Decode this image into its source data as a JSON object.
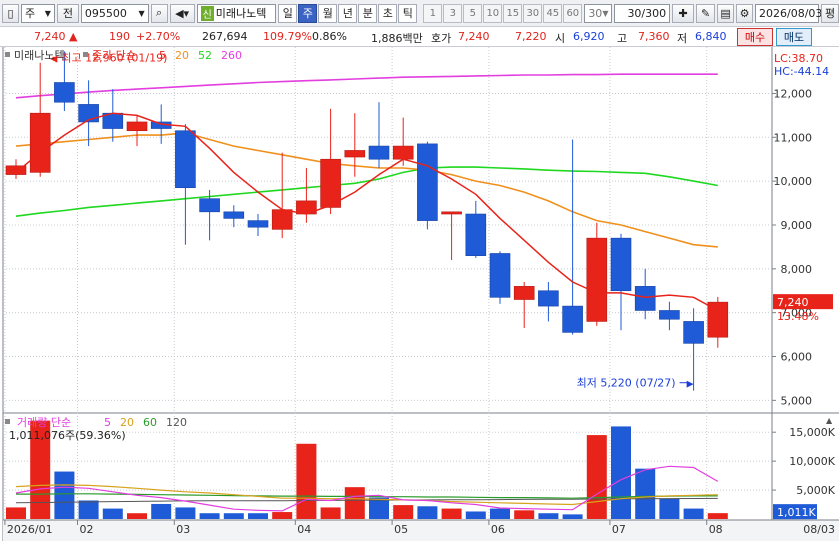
{
  "toolbar": {
    "mode": "주",
    "prev": "전",
    "code": "095500",
    "stock_tag": "신",
    "stock_name": "미래나노텍",
    "periods": [
      {
        "label": "일",
        "active": false
      },
      {
        "label": "주",
        "active": true
      },
      {
        "label": "월",
        "active": false
      },
      {
        "label": "년",
        "active": false
      },
      {
        "label": "분",
        "active": false
      },
      {
        "label": "초",
        "active": false
      },
      {
        "label": "틱",
        "active": false
      }
    ],
    "numbers": [
      "1",
      "3",
      "5",
      "10",
      "15",
      "30",
      "45",
      "60"
    ],
    "count": "30",
    "range": "30/300",
    "date": "2026/08/03",
    "date_btn": "평"
  },
  "quote": {
    "price": "7,240",
    "change": "190",
    "change_pct": "+2.70%",
    "volume": "267,694",
    "volume_ratio": "109.79%",
    "turnover": "0.86%",
    "amount": "1,886백만",
    "bid_ask_label": "호가",
    "ask": "7,240",
    "bid": "7,220",
    "open_label": "시",
    "open": "6,920",
    "high_label": "고",
    "high": "7,360",
    "low_label": "저",
    "low": "6,840",
    "buy_label": "매수",
    "sell_label": "매도"
  },
  "colors": {
    "up": "#e8231a",
    "down": "#1f5bd6",
    "ma5": "#e8231a",
    "ma20": "#f0901c",
    "ma52": "#1fd81f",
    "ma260": "#e23ee0",
    "vol_ma5": "#e23ee0",
    "vol_ma20": "#d8a21c",
    "vol_ma60": "#2a9a2a",
    "vol_ma120": "#555555"
  },
  "chart_data": [
    {
      "type": "candlestick",
      "legend": {
        "stock": "미래나노텍",
        "label": "종가 단순",
        "periods": [
          "5",
          "20",
          "52",
          "260"
        ]
      },
      "top_right": {
        "lc": "LC:38.70",
        "hc": "HC:-44.14"
      },
      "price_axis": {
        "ticks": [
          5000,
          6000,
          7000,
          8000,
          9000,
          10000,
          11000,
          12000
        ],
        "labels": [
          "5,000",
          "6,000",
          "7,000",
          "8,000",
          "9,000",
          "10,000",
          "11,000",
          "12,000"
        ]
      },
      "ylim": [
        4780,
        12900
      ],
      "x_labels": [
        {
          "i": 0,
          "label": "2026/01"
        },
        {
          "i": 3,
          "label": "02"
        },
        {
          "i": 7,
          "label": "03"
        },
        {
          "i": 12,
          "label": "04"
        },
        {
          "i": 16,
          "label": "05"
        },
        {
          "i": 20,
          "label": "06"
        },
        {
          "i": 25,
          "label": "07"
        },
        {
          "i": 29,
          "label": "08"
        }
      ],
      "x_end_label": "08/03",
      "candles": [
        {
          "o": 10150,
          "h": 10500,
          "l": 10050,
          "c": 10350
        },
        {
          "o": 10200,
          "h": 12700,
          "l": 10100,
          "c": 11550
        },
        {
          "o": 12250,
          "h": 12960,
          "l": 11600,
          "c": 11800
        },
        {
          "o": 11750,
          "h": 12300,
          "l": 10800,
          "c": 11350
        },
        {
          "o": 11550,
          "h": 12100,
          "l": 10900,
          "c": 11200
        },
        {
          "o": 11150,
          "h": 11500,
          "l": 10800,
          "c": 11350
        },
        {
          "o": 11350,
          "h": 11750,
          "l": 10850,
          "c": 11200
        },
        {
          "o": 11150,
          "h": 11300,
          "l": 8550,
          "c": 9850
        },
        {
          "o": 9600,
          "h": 9800,
          "l": 8650,
          "c": 9300
        },
        {
          "o": 9300,
          "h": 9450,
          "l": 8950,
          "c": 9150
        },
        {
          "o": 9100,
          "h": 9250,
          "l": 8750,
          "c": 8950
        },
        {
          "o": 8900,
          "h": 10650,
          "l": 8700,
          "c": 9350
        },
        {
          "o": 9250,
          "h": 10300,
          "l": 9050,
          "c": 9550
        },
        {
          "o": 9400,
          "h": 11650,
          "l": 9250,
          "c": 10500
        },
        {
          "o": 10550,
          "h": 11550,
          "l": 10100,
          "c": 10700
        },
        {
          "o": 10800,
          "h": 11800,
          "l": 10300,
          "c": 10500
        },
        {
          "o": 10500,
          "h": 11450,
          "l": 10350,
          "c": 10800
        },
        {
          "o": 10850,
          "h": 10900,
          "l": 8900,
          "c": 9100
        },
        {
          "o": 9250,
          "h": 9300,
          "l": 8200,
          "c": 9300
        },
        {
          "o": 9250,
          "h": 9550,
          "l": 8250,
          "c": 8300
        },
        {
          "o": 8350,
          "h": 8400,
          "l": 7200,
          "c": 7350
        },
        {
          "o": 7300,
          "h": 7700,
          "l": 6650,
          "c": 7600
        },
        {
          "o": 7500,
          "h": 7700,
          "l": 6800,
          "c": 7150
        },
        {
          "o": 7150,
          "h": 10950,
          "l": 6500,
          "c": 6550
        },
        {
          "o": 6800,
          "h": 9050,
          "l": 6700,
          "c": 8700
        },
        {
          "o": 8700,
          "h": 8800,
          "l": 6600,
          "c": 7500
        },
        {
          "o": 7600,
          "h": 8000,
          "l": 6850,
          "c": 7050
        },
        {
          "o": 7050,
          "h": 7250,
          "l": 6600,
          "c": 6850
        },
        {
          "o": 6800,
          "h": 7100,
          "l": 5220,
          "c": 6300
        },
        {
          "o": 6440,
          "h": 7360,
          "l": 6200,
          "c": 7240
        }
      ],
      "ma5": [
        10200,
        10650,
        11050,
        11400,
        11550,
        11500,
        11300,
        11250,
        10750,
        10200,
        9750,
        9350,
        9250,
        9450,
        9750,
        10150,
        10500,
        10350,
        10050,
        9700,
        9150,
        8650,
        8150,
        7700,
        7450,
        7450,
        7350,
        7400,
        7350,
        7050
      ],
      "ma20": [
        10800,
        10850,
        10900,
        10950,
        11000,
        11050,
        11050,
        11100,
        10950,
        10800,
        10700,
        10600,
        10500,
        10400,
        10350,
        10300,
        10300,
        10250,
        10150,
        10000,
        9900,
        9750,
        9550,
        9300,
        9100,
        9000,
        8850,
        8700,
        8550,
        8500
      ],
      "ma52": [
        9200,
        9270,
        9330,
        9400,
        9450,
        9500,
        9550,
        9600,
        9650,
        9700,
        9750,
        9800,
        9850,
        9900,
        9950,
        10050,
        10200,
        10300,
        10320,
        10320,
        10300,
        10280,
        10250,
        10230,
        10220,
        10200,
        10180,
        10100,
        10000,
        9900
      ],
      "ma260": [
        11900,
        11950,
        11990,
        12030,
        12070,
        12100,
        12130,
        12160,
        12190,
        12220,
        12250,
        12270,
        12290,
        12310,
        12330,
        12350,
        12370,
        12380,
        12390,
        12400,
        12410,
        12420,
        12420,
        12430,
        12430,
        12440,
        12440,
        12440,
        12440,
        12440
      ],
      "annotations": [
        {
          "label": "최고 12,960 (01/19)",
          "i": 2,
          "value": 12960,
          "side": "right"
        },
        {
          "label": "최저 5,220 (07/27)",
          "i": 28,
          "value": 5220,
          "side": "left"
        }
      ],
      "last_price_label": "7,240",
      "last_change_label": "13.48%"
    },
    {
      "type": "bar",
      "legend": {
        "label": "거래량 단순",
        "periods": [
          "5",
          "20",
          "60",
          "120"
        ]
      },
      "header_value": "1,011,076주(59.36%)",
      "axis": {
        "ticks": [
          5000,
          10000,
          15000
        ],
        "labels": [
          "5,000K",
          "10,000K",
          "15,000K"
        ]
      },
      "ylim": [
        0,
        17800
      ],
      "values": [
        2000,
        17000,
        8200,
        3200,
        1800,
        1000,
        2600,
        2000,
        1000,
        1000,
        1000,
        1200,
        13000,
        2000,
        5500,
        3700,
        2400,
        2200,
        1800,
        1300,
        1800,
        1500,
        1000,
        800,
        14500,
        16000,
        8700,
        3500,
        1800,
        1011
      ],
      "ma5": [
        4500,
        5200,
        5500,
        5300,
        4700,
        4100,
        3700,
        3100,
        2400,
        1700,
        1500,
        1400,
        3400,
        3200,
        3900,
        4100,
        3300,
        3200,
        2800,
        2500,
        1900,
        1800,
        1700,
        1600,
        4300,
        6800,
        8500,
        9100,
        8900,
        6500
      ],
      "ma20": [
        5600,
        5800,
        5900,
        5800,
        5600,
        5300,
        5000,
        4700,
        4500,
        4200,
        3900,
        3600,
        3600,
        3500,
        3500,
        3400,
        3300,
        3200,
        3000,
        2900,
        2800,
        2700,
        2600,
        2500,
        3000,
        3500,
        3800,
        4000,
        4100,
        4200
      ],
      "ma60": [
        4300,
        4300,
        4350,
        4350,
        4300,
        4250,
        4200,
        4150,
        4100,
        4050,
        4000,
        3950,
        3950,
        3900,
        3900,
        3850,
        3850,
        3800,
        3800,
        3750,
        3700,
        3700,
        3650,
        3600,
        3700,
        3800,
        3900,
        3950,
        4000,
        4000
      ],
      "ma120": [
        2800,
        2850,
        2900,
        2950,
        3000,
        3050,
        3100,
        3120,
        3140,
        3150,
        3160,
        3170,
        3200,
        3220,
        3240,
        3260,
        3280,
        3300,
        3320,
        3340,
        3360,
        3380,
        3400,
        3420,
        3450,
        3480,
        3500,
        3520,
        3540,
        3560
      ],
      "last_value_label": "1,011K",
      "last_pct_label": "59.36%"
    }
  ]
}
